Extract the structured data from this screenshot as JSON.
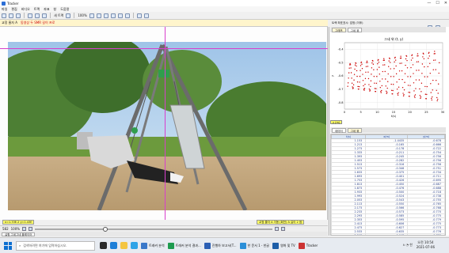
{
  "window": {
    "title": "Tracker",
    "controls": [
      "—",
      "☐",
      "✕"
    ]
  },
  "menu": [
    "파일",
    "편집",
    "비디오",
    "트랙",
    "좌표",
    "창",
    "도움말"
  ],
  "toolbar": {
    "capture_label": "새 트랙",
    "zoom_label": "100%"
  },
  "info_strip": {
    "left": "교정 줄자 A",
    "right_red": "동영상 두 SMR 길이 프로",
    "right": "트랙 좌표표시: 앞점 (이후)"
  },
  "video_overlay": {
    "top_left_label": ""
  },
  "coords": {
    "left": "x=1.33E.2  y=1.43E",
    "right": "교정 줄자 A 이동 (회전) A 길이 2 점"
  },
  "player": {
    "frame": "582",
    "zoom": "100%"
  },
  "bottom_tab": "실험 그네그네 플레이어",
  "plot": {
    "tabs": [
      "그래프",
      "그네 위"
    ],
    "title": "그네 위 (t, y)",
    "x_label": "t(s)",
    "y_label": "y",
    "corner_badge": "y (m)"
  },
  "chart_data": {
    "type": "scatter",
    "title": "그네 위 (t, y)",
    "xlabel": "t(s)",
    "ylabel": "y",
    "xlim": [
      0,
      30
    ],
    "ylim": [
      -0.85,
      -0.35
    ],
    "x_ticks": [
      0,
      5,
      10,
      15,
      20,
      25,
      30
    ],
    "y_ticks": [
      -0.4,
      -0.5,
      -0.6,
      -0.7,
      -0.8
    ],
    "series": [
      {
        "color": "#cc0000",
        "period": 1.72,
        "x_range": [
          1,
          29
        ],
        "amplitude_start": 0.09,
        "amplitude_end": 0.19,
        "center": -0.6
      }
    ]
  },
  "table": {
    "tabs": [
      "데이터",
      "그네 위"
    ],
    "headers": [
      "t(s)",
      "x(m)",
      "y(m)"
    ],
    "rows": [
      [
        "1.153",
        "-1.4435",
        "-0.678"
      ],
      [
        "1.213",
        "-0.165",
        "-0.666"
      ],
      [
        "1.273",
        "-0.178",
        "-0.722"
      ],
      [
        "1.333",
        "-0.211",
        "-0.754"
      ],
      [
        "1.393",
        "-0.245",
        "-0.756"
      ],
      [
        "1.453",
        "-0.282",
        "-0.756"
      ],
      [
        "1.513",
        "-0.316",
        "-0.756"
      ],
      [
        "1.573",
        "-0.346",
        "-0.751"
      ],
      [
        "1.633",
        "-0.375",
        "-0.734"
      ],
      [
        "1.693",
        "-0.401",
        "-0.711"
      ],
      [
        "1.753",
        "-0.426",
        "-0.695"
      ],
      [
        "1.813",
        "-0.450",
        "-0.687"
      ],
      [
        "1.873",
        "-0.476",
        "-0.688"
      ],
      [
        "1.933",
        "-0.500",
        "-0.718"
      ],
      [
        "1.993",
        "-0.524",
        "-0.738"
      ],
      [
        "2.053",
        "-0.543",
        "-0.755"
      ],
      [
        "2.113",
        "-0.550",
        "-0.765"
      ],
      [
        "2.173",
        "-0.566",
        "-0.768"
      ],
      [
        "2.233",
        "-0.573",
        "-0.770"
      ],
      [
        "2.293",
        "-0.585",
        "-0.775"
      ],
      [
        "2.353",
        "-0.595",
        "-0.779"
      ],
      [
        "2.413",
        "-0.606",
        "-0.775"
      ],
      [
        "2.473",
        "-0.627",
        "-0.773"
      ],
      [
        "2.533",
        "-0.635",
        "-0.776"
      ],
      [
        "2.593",
        "-0.648",
        "-0.776"
      ],
      [
        "2.653",
        "-0.662",
        "-0.777"
      ]
    ]
  },
  "taskbar": {
    "search_placeholder": "검색하려면 여기에 입력하십시오.",
    "items": [
      "트래커 분석",
      "트래커 분석 결과...",
      "진행하 보고서(T...",
      "한 문서 1 - 한글",
      "영화 및 TV",
      "Tracker"
    ],
    "time": "오전 10:54",
    "date": "2021-07-06",
    "tray": "∧  ◔  한"
  }
}
